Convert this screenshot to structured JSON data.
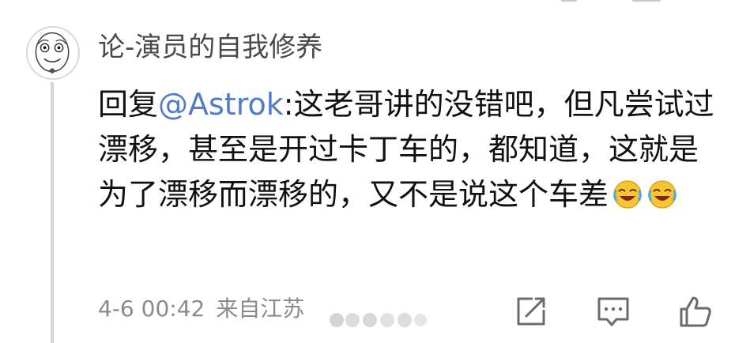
{
  "comment": {
    "username": "论-演员的自我修养",
    "reply_prefix": "回复",
    "mention": "@Astrok",
    "text": ":这老哥讲的没错吧，但凡尝试过漂移，甚至是开过卡丁车的，都知道，这就是为了漂移而漂移的，又不是说这个车差",
    "emojis": [
      "laughing-crying-emoji",
      "laughing-crying-emoji"
    ],
    "timestamp": "4-6 00:42",
    "location": "来自江苏"
  },
  "actions": {
    "icons": [
      "share-icon",
      "comment-icon",
      "like-icon"
    ]
  },
  "colors": {
    "mention": "#4f7cc4",
    "meta": "#8a8a8a",
    "thread_line": "#d6d6d6"
  }
}
